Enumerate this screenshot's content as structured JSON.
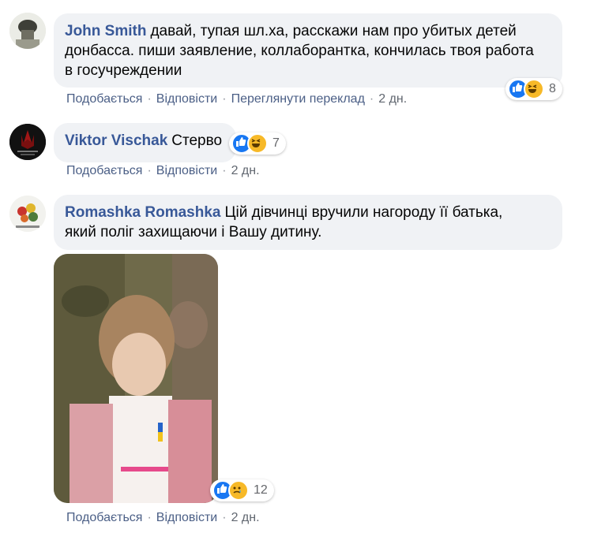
{
  "comments": [
    {
      "author": "John Smith",
      "text_line1": "давай, тупая шл.ха, расскажи нам про убитых детей",
      "text_line2": "донбасса. пиши заявление, коллаборантка, кончилась твоя работа",
      "text_line3": "в госучреждении",
      "actions": [
        "Подобається",
        "Відповісти",
        "Переглянути переклад"
      ],
      "time": "2 дн.",
      "reaction_count": "8",
      "reaction_icons": [
        "like-icon",
        "haha-icon"
      ]
    },
    {
      "author": "Viktor Vischak",
      "text_line1": "Стерво",
      "actions": [
        "Подобається",
        "Відповісти"
      ],
      "time": "2 дн.",
      "reaction_count": "7",
      "reaction_icons": [
        "like-icon",
        "haha-icon"
      ]
    },
    {
      "author": "Romashka Romashka",
      "text_line1": "Цій дівчинці вручили нагороду її батька,",
      "text_line2": "який поліг захищаючи і Вашу дитину.",
      "actions": [
        "Подобається",
        "Відповісти"
      ],
      "time": "2 дн.",
      "reaction_count": "12",
      "reaction_icons": [
        "like-icon",
        "sad-icon"
      ]
    }
  ],
  "colors": {
    "bubble_bg": "#f0f2f5",
    "author": "#385898",
    "action_link": "#4b5f86",
    "like_blue": "#1877f2",
    "emoji_yellow": "#f7b928"
  }
}
